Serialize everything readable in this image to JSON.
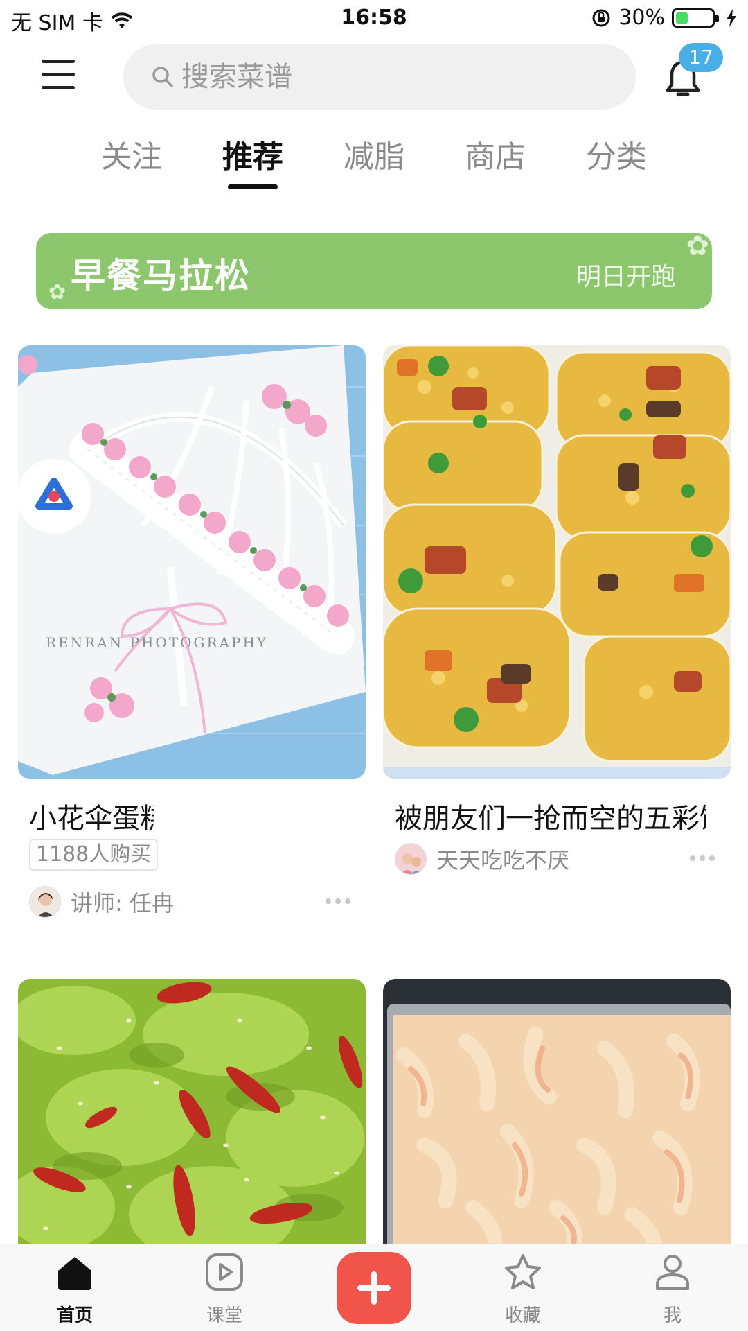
{
  "status_bar": {
    "carrier": "无 SIM 卡",
    "time": "16:58",
    "battery_percent": "30%",
    "battery_level": 0.3,
    "icons": [
      "wifi-icon",
      "rotation-lock-icon",
      "battery-icon",
      "charging-icon"
    ]
  },
  "header": {
    "search_placeholder": "搜索菜谱",
    "notification_count": "17"
  },
  "tabs": [
    {
      "label": "关注",
      "active": false
    },
    {
      "label": "推荐",
      "active": true
    },
    {
      "label": "减脂",
      "active": false
    },
    {
      "label": "商店",
      "active": false
    },
    {
      "label": "分类",
      "active": false
    }
  ],
  "banner": {
    "title": "早餐马拉松",
    "cta": "明日开跑",
    "color": "#8cc66d"
  },
  "feed": [
    {
      "title": "小花伞蛋糕",
      "purchase_count": "1188人购买",
      "author": "讲师: 任冉",
      "image_watermark": "RENRAN PHOTOGRAPHY",
      "image": "umbrella-cake"
    },
    {
      "title": "被朋友们一抢而空的五彩饭团",
      "author": "天天吃吃不厌",
      "image": "colorful-rice-rolls"
    },
    {
      "title": "",
      "image": "green-vegetable-dish"
    },
    {
      "title": "",
      "image": "fried-dough-strips"
    }
  ],
  "bottom_nav": [
    {
      "label": "首页",
      "icon": "home-icon",
      "active": true
    },
    {
      "label": "课堂",
      "icon": "play-icon",
      "active": false
    },
    {
      "label": "",
      "icon": "plus-icon",
      "active": false
    },
    {
      "label": "收藏",
      "icon": "star-icon",
      "active": false
    },
    {
      "label": "我",
      "icon": "person-icon",
      "active": false
    }
  ],
  "colors": {
    "accent_red": "#f0544a",
    "badge_blue": "#4aaee6",
    "banner_green": "#8cc66d"
  }
}
